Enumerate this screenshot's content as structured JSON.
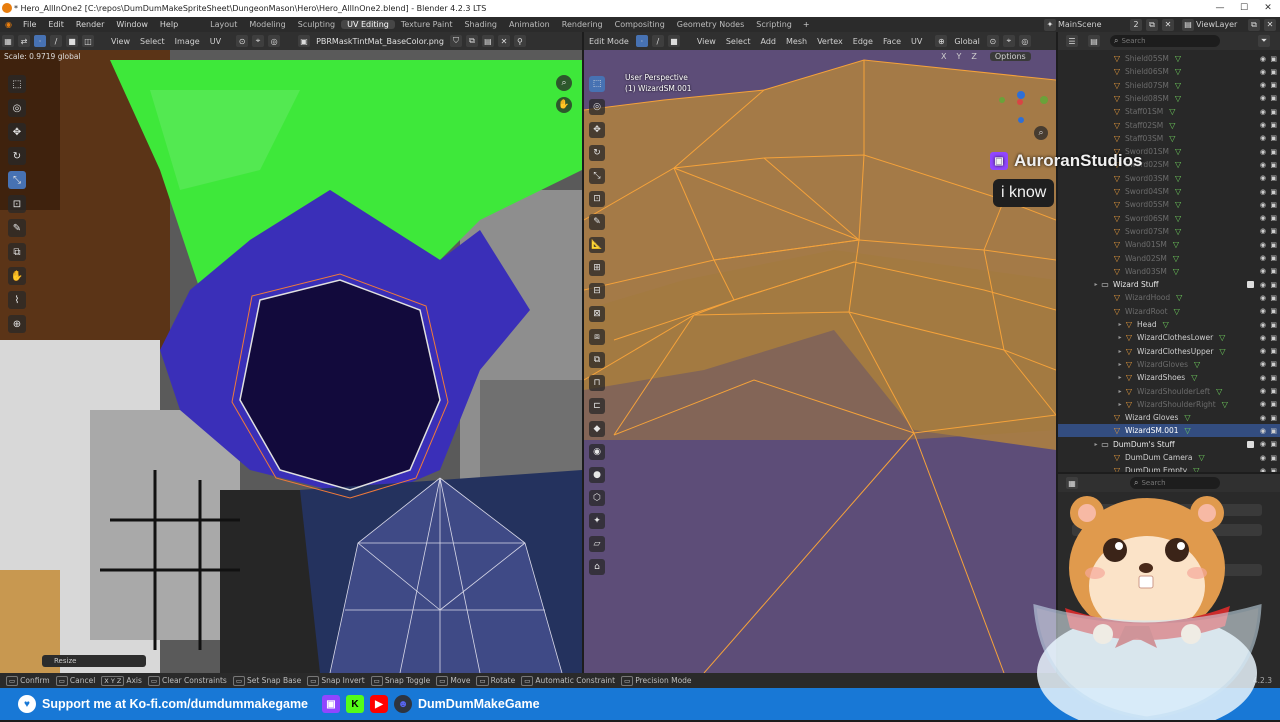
{
  "window": {
    "title": "* Hero_AllInOne2 [C:\\repos\\DumDumMakeSpriteSheet\\DungeonMason\\Hero\\Hero_AllInOne2.blend] - Blender 4.2.3 LTS",
    "minimize": "—",
    "maximize": "☐",
    "close": "✕"
  },
  "menubar": {
    "menus": [
      "File",
      "Edit",
      "Render",
      "Window",
      "Help"
    ],
    "workspaces": [
      "Layout",
      "Modeling",
      "Sculpting",
      "UV Editing",
      "Texture Paint",
      "Shading",
      "Animation",
      "Rendering",
      "Compositing",
      "Geometry Nodes",
      "Scripting"
    ],
    "active_workspace": "UV Editing",
    "add_workspace": "+",
    "scene": "MainScene",
    "scene_users": "2",
    "view_layer": "ViewLayer"
  },
  "uv_editor": {
    "header_menus": [
      "View",
      "Select",
      "Image",
      "UV"
    ],
    "image_name": "PBRMaskTintMat_BaseColor.png",
    "operator_status": "Scale: 0.9719 global",
    "last_operator": "Resize",
    "tool_icons": [
      "select-box-icon",
      "cursor-icon",
      "move-icon",
      "rotate-icon",
      "scale-icon",
      "transform-icon",
      "annotate-icon",
      "rip-icon",
      "grab-icon",
      "relax-icon",
      "pinch-icon"
    ],
    "tool_glyphs": [
      "⬚",
      "◎",
      "✥",
      "↻",
      "⤡",
      "⊡",
      "✎",
      "⧉",
      "✋",
      "⌇",
      "⊕"
    ],
    "active_tool": 4,
    "nav_glyphs": [
      "⌕",
      "✋"
    ]
  },
  "viewport": {
    "mode": "Edit Mode",
    "header_menus": [
      "View",
      "Select",
      "Add",
      "Mesh",
      "Vertex",
      "Edge",
      "Face",
      "UV"
    ],
    "transform_orientation": "Global",
    "options_label": "Options",
    "axes": [
      "X",
      "Y",
      "Z"
    ],
    "view_name": "User Perspective",
    "object_name": "(1) WizardSM.001",
    "tool_glyphs": [
      "⬚",
      "◎",
      "✥",
      "↻",
      "⤡",
      "⊡",
      "✎",
      "📐",
      "⊞",
      "⊟",
      "⊠",
      "⧈",
      "⧉",
      "⊓",
      "⊏",
      "◆",
      "◉",
      "●",
      "⬡",
      "✦",
      "▱",
      "⌂"
    ],
    "active_tool": 0
  },
  "outliner": {
    "search_placeholder": "Search",
    "items": [
      {
        "label": "Shield05SM",
        "depth": 2,
        "dim": true
      },
      {
        "label": "Shield06SM",
        "depth": 2,
        "dim": true
      },
      {
        "label": "Shield07SM",
        "depth": 2,
        "dim": true
      },
      {
        "label": "Shield08SM",
        "depth": 2,
        "dim": true
      },
      {
        "label": "Staff01SM",
        "depth": 2,
        "dim": true
      },
      {
        "label": "Staff02SM",
        "depth": 2,
        "dim": true
      },
      {
        "label": "Staff03SM",
        "depth": 2,
        "dim": true
      },
      {
        "label": "Sword01SM",
        "depth": 2,
        "dim": true
      },
      {
        "label": "Sword02SM",
        "depth": 2,
        "dim": true
      },
      {
        "label": "Sword03SM",
        "depth": 2,
        "dim": true
      },
      {
        "label": "Sword04SM",
        "depth": 2,
        "dim": true
      },
      {
        "label": "Sword05SM",
        "depth": 2,
        "dim": true
      },
      {
        "label": "Sword06SM",
        "depth": 2,
        "dim": true
      },
      {
        "label": "Sword07SM",
        "depth": 2,
        "dim": true
      },
      {
        "label": "Wand01SM",
        "depth": 2,
        "dim": true
      },
      {
        "label": "Wand02SM",
        "depth": 2,
        "dim": true
      },
      {
        "label": "Wand03SM",
        "depth": 2,
        "dim": true
      },
      {
        "label": "Wizard Stuff",
        "depth": 1,
        "dim": false,
        "collection": true
      },
      {
        "label": "WizardHood",
        "depth": 2,
        "dim": true
      },
      {
        "label": "WizardRoot",
        "depth": 2,
        "dim": true
      },
      {
        "label": "Head",
        "depth": 3,
        "dim": false
      },
      {
        "label": "WizardClothesLower",
        "depth": 3,
        "dim": false
      },
      {
        "label": "WizardClothesUpper",
        "depth": 3,
        "dim": false
      },
      {
        "label": "WizardGloves",
        "depth": 3,
        "dim": true
      },
      {
        "label": "WizardShoes",
        "depth": 3,
        "dim": false
      },
      {
        "label": "WizardShoulderLeft",
        "depth": 3,
        "dim": true
      },
      {
        "label": "WizardShoulderRight",
        "depth": 3,
        "dim": true
      },
      {
        "label": "Wizard Gloves",
        "depth": 2,
        "dim": false
      },
      {
        "label": "WizardSM.001",
        "depth": 2,
        "dim": false,
        "selected": true
      },
      {
        "label": "DumDum's Stuff",
        "depth": 1,
        "dim": false,
        "collection": true
      },
      {
        "label": "DumDum Camera",
        "depth": 2,
        "dim": false
      },
      {
        "label": "DumDum Empty",
        "depth": 2,
        "dim": false
      }
    ]
  },
  "properties": {
    "search_placeholder": "Search"
  },
  "statusbar": {
    "items": [
      {
        "key": "",
        "label": "Confirm"
      },
      {
        "key": "",
        "label": "Cancel"
      },
      {
        "key": "X Y Z",
        "label": "Axis"
      },
      {
        "key": "",
        "label": "Clear Constraints"
      },
      {
        "key": "",
        "label": "Set Snap Base"
      },
      {
        "key": "",
        "label": "Snap Invert"
      },
      {
        "key": "",
        "label": "Snap Toggle"
      },
      {
        "key": "",
        "label": "Move"
      },
      {
        "key": "",
        "label": "Rotate"
      },
      {
        "key": "",
        "label": "Automatic Constraint"
      },
      {
        "key": "",
        "label": "Precision Mode"
      }
    ],
    "version": "4.2.3"
  },
  "stream_overlay": {
    "chat_user": "AuroranStudios",
    "chat_message": "i know",
    "kofi_text": "Support me at Ko-fi.com/dumdummakegame",
    "channel_name": "DumDumMakeGame",
    "colors": {
      "banner": "#1878d6",
      "twitch": "#9146ff",
      "youtube": "#ff0000",
      "kick": "#53fc18"
    }
  }
}
